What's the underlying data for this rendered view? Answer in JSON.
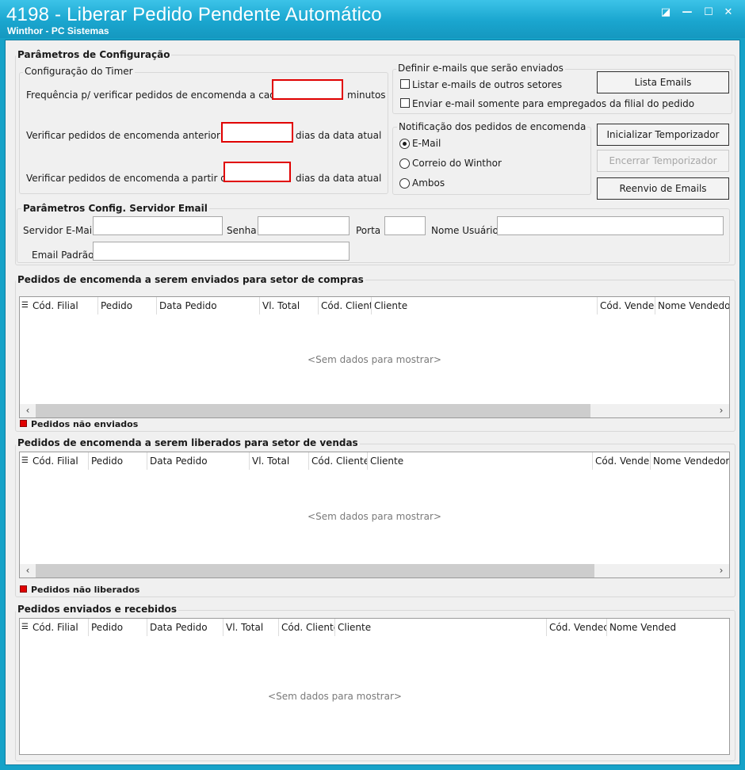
{
  "window": {
    "title": "4198 - Liberar Pedido Pendente Automático",
    "subtitle": "Winthor - PC Sistemas",
    "controls": {
      "restore": "◪",
      "minimize": "—",
      "maximize": "☐",
      "close": "✕"
    }
  },
  "config": {
    "group_title": "Parâmetros de Configuração",
    "timer": {
      "title": "Configuração do Timer",
      "freq_label": "Frequência p/ verificar pedidos de encomenda a cada",
      "freq_suffix": "minutos",
      "anterior_label": "Verificar pedidos de encomenda anterior a",
      "anterior_suffix": "dias da data atual",
      "partir_label": "Verificar pedidos de encomenda a partir de",
      "partir_suffix": "dias da data atual"
    },
    "emails": {
      "title": "Definir e-mails que serão enviados",
      "listar_label": "Listar e-mails de outros setores",
      "enviar_label": "Enviar e-mail somente para empregados da filial do pedido",
      "lista_button": "Lista Emails"
    },
    "notificacao": {
      "title": "Notificação dos pedidos de encomenda",
      "options": [
        "E-Mail",
        "Correio do Winthor",
        "Ambos"
      ]
    },
    "buttons": {
      "iniciar": "Inicializar Temporizador",
      "encerrar": "Encerrar Temporizador",
      "reenvio": "Reenvio de Emails"
    },
    "server": {
      "title": "Parâmetros Config. Servidor Email",
      "servidor_label": "Servidor E-Mail",
      "senha_label": "Senha",
      "porta_label": "Porta",
      "usuario_label": "Nome Usuário",
      "email_label": "Email Padrão"
    }
  },
  "grids": {
    "compras": {
      "title": "Pedidos de encomenda a serem enviados para setor de compras",
      "columns": [
        "Cód. Filial",
        "Pedido",
        "Data Pedido",
        "Vl. Total",
        "Cód. Client",
        "Cliente",
        "Cód. Vended",
        "Nome Vendedor"
      ],
      "empty": "<Sem dados para mostrar>",
      "legend": "Pedidos não enviados"
    },
    "vendas": {
      "title": "Pedidos de encomenda a serem liberados para setor de vendas",
      "columns": [
        "Cód. Filial",
        "Pedido",
        "Data Pedido",
        "Vl. Total",
        "Cód. Cliente",
        "Cliente",
        "Cód. Vende",
        "Nome Vendedor"
      ],
      "empty": "<Sem dados para mostrar>",
      "legend": "Pedidos não liberados"
    },
    "enviados": {
      "title": "Pedidos enviados e recebidos",
      "columns": [
        "Cód. Filial",
        "Pedido",
        "Data Pedido",
        "Vl. Total",
        "Cód. Cliente",
        "Cliente",
        "Cód. Vendec",
        "Nome Vended"
      ],
      "empty": "<Sem dados para mostrar>"
    }
  },
  "icons": {
    "grid_menu": "☰",
    "scroll_left": "‹",
    "scroll_right": "›"
  },
  "colors": {
    "title_bar": "#1aa6cf",
    "required_border": "#e00000",
    "legend_red": "#e00000"
  }
}
